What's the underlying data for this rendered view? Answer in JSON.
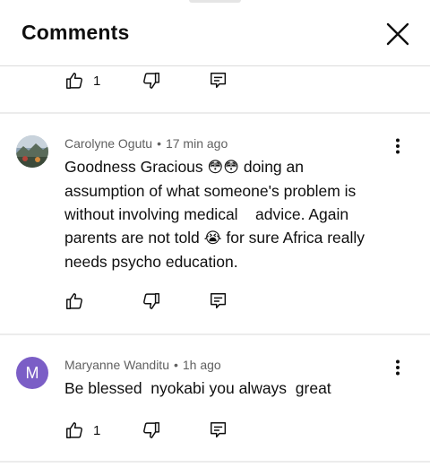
{
  "header": {
    "title": "Comments"
  },
  "comments": [
    {
      "likes": "1"
    },
    {
      "author": "Carolyne Ogutu",
      "time": "17 min ago",
      "text_parts": [
        "Goodness Gracious ",
        "😳😳",
        " doing an assumption of what someone's problem is without involving medical    advice. Again parents are not told ",
        "😭",
        " for sure Africa really needs psycho education."
      ],
      "likes": ""
    },
    {
      "author": "Maryanne Wanditu",
      "time": "1h ago",
      "avatar_letter": "M",
      "text": "Be blessed  nyokabi you always  great",
      "likes": "1"
    }
  ],
  "icons": {
    "like": "thumb-up-icon",
    "dislike": "thumb-down-icon",
    "reply": "reply-icon",
    "more": "more-vert-icon",
    "close": "close-icon"
  },
  "colors": {
    "avatar_m": "#7b5ec6",
    "meta": "#606060",
    "divider": "#ececec"
  }
}
